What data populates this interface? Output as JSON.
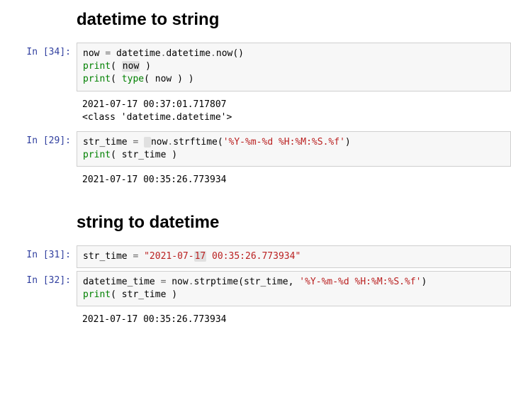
{
  "heading1": "datetime to string",
  "heading2": "string to datetime",
  "prompts": {
    "c34": "In [34]:",
    "c29": "In [29]:",
    "c31": "In [31]:",
    "c32": "In [32]:"
  },
  "c34": {
    "l1a": "now ",
    "l1eq": "= ",
    "l1b": "datetime",
    "l1dot1": ".",
    "l1c": "datetime",
    "l1dot2": ".",
    "l1d": "now()",
    "l2a": "print",
    "l2b": "( ",
    "l2c": "now",
    "l2d": " )",
    "l3a": "print",
    "l3b": "( ",
    "l3c": "type",
    "l3d": "( now ) )"
  },
  "out34": "2021-07-17 00:37:01.717807\n<class 'datetime.datetime'>",
  "c29": {
    "l1a": "str_time ",
    "l1eq": "= ",
    "l1sp": " ",
    "l1b": "now",
    "l1dot": ".",
    "l1c": "strftime(",
    "l1str": "'%Y-%m-%d %H:%M:%S.%f'",
    "l1d": ")",
    "l2a": "print",
    "l2b": "( str_time )"
  },
  "out29": "2021-07-17 00:35:26.773934",
  "c31": {
    "l1a": "str_time ",
    "l1eq": "= ",
    "l1s1": "\"2021-07-",
    "l1s2": "17",
    "l1s3": " 00:35:26.773934\""
  },
  "c32": {
    "l1a": "datetime_time ",
    "l1eq": "= ",
    "l1b": "now",
    "l1dot": ".",
    "l1c": "strptime(str_time, ",
    "l1str": "'%Y-%m-%d %H:%M:%S.%f'",
    "l1d": ")",
    "l2a": "print",
    "l2b": "( str_time )"
  },
  "out32": "2021-07-17 00:35:26.773934"
}
